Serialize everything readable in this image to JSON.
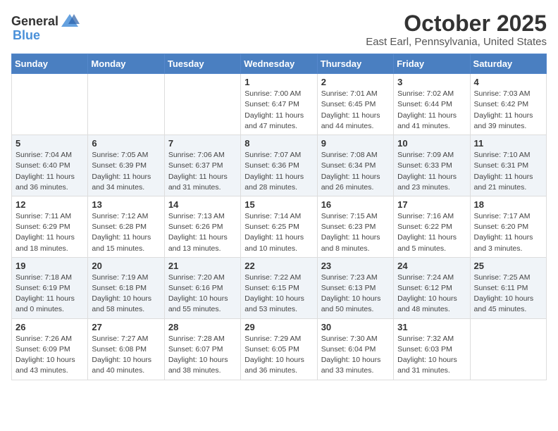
{
  "logo": {
    "general": "General",
    "blue": "Blue"
  },
  "header": {
    "month": "October 2025",
    "location": "East Earl, Pennsylvania, United States"
  },
  "days_of_week": [
    "Sunday",
    "Monday",
    "Tuesday",
    "Wednesday",
    "Thursday",
    "Friday",
    "Saturday"
  ],
  "weeks": [
    [
      {
        "day": "",
        "info": ""
      },
      {
        "day": "",
        "info": ""
      },
      {
        "day": "",
        "info": ""
      },
      {
        "day": "1",
        "info": "Sunrise: 7:00 AM\nSunset: 6:47 PM\nDaylight: 11 hours\nand 47 minutes."
      },
      {
        "day": "2",
        "info": "Sunrise: 7:01 AM\nSunset: 6:45 PM\nDaylight: 11 hours\nand 44 minutes."
      },
      {
        "day": "3",
        "info": "Sunrise: 7:02 AM\nSunset: 6:44 PM\nDaylight: 11 hours\nand 41 minutes."
      },
      {
        "day": "4",
        "info": "Sunrise: 7:03 AM\nSunset: 6:42 PM\nDaylight: 11 hours\nand 39 minutes."
      }
    ],
    [
      {
        "day": "5",
        "info": "Sunrise: 7:04 AM\nSunset: 6:40 PM\nDaylight: 11 hours\nand 36 minutes."
      },
      {
        "day": "6",
        "info": "Sunrise: 7:05 AM\nSunset: 6:39 PM\nDaylight: 11 hours\nand 34 minutes."
      },
      {
        "day": "7",
        "info": "Sunrise: 7:06 AM\nSunset: 6:37 PM\nDaylight: 11 hours\nand 31 minutes."
      },
      {
        "day": "8",
        "info": "Sunrise: 7:07 AM\nSunset: 6:36 PM\nDaylight: 11 hours\nand 28 minutes."
      },
      {
        "day": "9",
        "info": "Sunrise: 7:08 AM\nSunset: 6:34 PM\nDaylight: 11 hours\nand 26 minutes."
      },
      {
        "day": "10",
        "info": "Sunrise: 7:09 AM\nSunset: 6:33 PM\nDaylight: 11 hours\nand 23 minutes."
      },
      {
        "day": "11",
        "info": "Sunrise: 7:10 AM\nSunset: 6:31 PM\nDaylight: 11 hours\nand 21 minutes."
      }
    ],
    [
      {
        "day": "12",
        "info": "Sunrise: 7:11 AM\nSunset: 6:29 PM\nDaylight: 11 hours\nand 18 minutes."
      },
      {
        "day": "13",
        "info": "Sunrise: 7:12 AM\nSunset: 6:28 PM\nDaylight: 11 hours\nand 15 minutes."
      },
      {
        "day": "14",
        "info": "Sunrise: 7:13 AM\nSunset: 6:26 PM\nDaylight: 11 hours\nand 13 minutes."
      },
      {
        "day": "15",
        "info": "Sunrise: 7:14 AM\nSunset: 6:25 PM\nDaylight: 11 hours\nand 10 minutes."
      },
      {
        "day": "16",
        "info": "Sunrise: 7:15 AM\nSunset: 6:23 PM\nDaylight: 11 hours\nand 8 minutes."
      },
      {
        "day": "17",
        "info": "Sunrise: 7:16 AM\nSunset: 6:22 PM\nDaylight: 11 hours\nand 5 minutes."
      },
      {
        "day": "18",
        "info": "Sunrise: 7:17 AM\nSunset: 6:20 PM\nDaylight: 11 hours\nand 3 minutes."
      }
    ],
    [
      {
        "day": "19",
        "info": "Sunrise: 7:18 AM\nSunset: 6:19 PM\nDaylight: 11 hours\nand 0 minutes."
      },
      {
        "day": "20",
        "info": "Sunrise: 7:19 AM\nSunset: 6:18 PM\nDaylight: 10 hours\nand 58 minutes."
      },
      {
        "day": "21",
        "info": "Sunrise: 7:20 AM\nSunset: 6:16 PM\nDaylight: 10 hours\nand 55 minutes."
      },
      {
        "day": "22",
        "info": "Sunrise: 7:22 AM\nSunset: 6:15 PM\nDaylight: 10 hours\nand 53 minutes."
      },
      {
        "day": "23",
        "info": "Sunrise: 7:23 AM\nSunset: 6:13 PM\nDaylight: 10 hours\nand 50 minutes."
      },
      {
        "day": "24",
        "info": "Sunrise: 7:24 AM\nSunset: 6:12 PM\nDaylight: 10 hours\nand 48 minutes."
      },
      {
        "day": "25",
        "info": "Sunrise: 7:25 AM\nSunset: 6:11 PM\nDaylight: 10 hours\nand 45 minutes."
      }
    ],
    [
      {
        "day": "26",
        "info": "Sunrise: 7:26 AM\nSunset: 6:09 PM\nDaylight: 10 hours\nand 43 minutes."
      },
      {
        "day": "27",
        "info": "Sunrise: 7:27 AM\nSunset: 6:08 PM\nDaylight: 10 hours\nand 40 minutes."
      },
      {
        "day": "28",
        "info": "Sunrise: 7:28 AM\nSunset: 6:07 PM\nDaylight: 10 hours\nand 38 minutes."
      },
      {
        "day": "29",
        "info": "Sunrise: 7:29 AM\nSunset: 6:05 PM\nDaylight: 10 hours\nand 36 minutes."
      },
      {
        "day": "30",
        "info": "Sunrise: 7:30 AM\nSunset: 6:04 PM\nDaylight: 10 hours\nand 33 minutes."
      },
      {
        "day": "31",
        "info": "Sunrise: 7:32 AM\nSunset: 6:03 PM\nDaylight: 10 hours\nand 31 minutes."
      },
      {
        "day": "",
        "info": ""
      }
    ]
  ]
}
